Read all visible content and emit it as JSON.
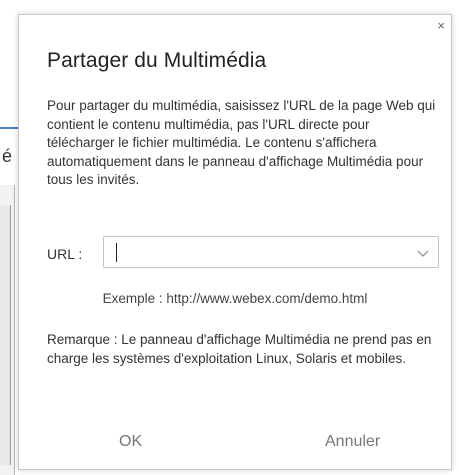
{
  "dialog": {
    "title": "Partager du Multimédia",
    "close_glyph": "×",
    "description": "Pour partager du multimédia, saisissez l'URL de la page Web qui contient le contenu multimédia, pas l'URL directe pour télécharger le fichier multimédia. Le contenu s'affichera automatiquement dans le panneau d'affichage Multimédia pour tous les invités.",
    "url_label": "URL :",
    "url_value": "",
    "example": "Exemple : http://www.webex.com/demo.html",
    "note": "Remarque : Le panneau d'affichage Multimédia ne prend pas en charge les systèmes d'exploitation Linux, Solaris et mobiles.",
    "ok_label": "OK",
    "cancel_label": "Annuler"
  },
  "background": {
    "partial_letter": "é"
  },
  "icons": {
    "close": "close-icon",
    "dropdown": "chevron-down-icon"
  },
  "colors": {
    "text": "#333333",
    "button_text": "#777777",
    "field_border": "#c4c4c4",
    "accent_blue": "#4a7fc0"
  }
}
